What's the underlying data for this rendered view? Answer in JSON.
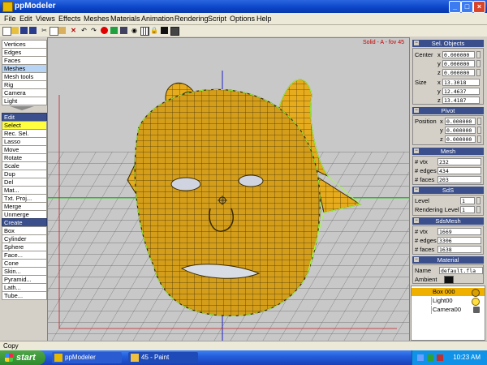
{
  "window": {
    "title": "ppModeler"
  },
  "menu": [
    "File",
    "Edit",
    "Views",
    "Effects",
    "Meshes",
    "Materials",
    "Animation",
    "Rendering",
    "Script",
    "Options",
    "Help"
  ],
  "toolbar_icons": [
    "new-icon",
    "open-icon",
    "save-icon",
    "save-as-icon",
    "cut-icon",
    "copy-icon",
    "paste-icon",
    "delete-icon",
    "undo-icon",
    "redo-icon",
    "record-icon",
    "render-icon",
    "preview-icon",
    "eye-icon",
    "grid-icon",
    "lock-icon",
    "view-mode-icon",
    "layout-icon"
  ],
  "left_panel": {
    "modes": [
      "Vertices",
      "Edges",
      "Faces",
      "Meshes",
      "Mesh tools",
      "Rig",
      "Camera",
      "Light"
    ],
    "edit_header": "Edit",
    "edit_items": [
      "Select",
      "Rec. Sel.",
      "Lasso",
      "Move",
      "Rotate",
      "Scale",
      "Dup",
      "Del",
      "Mat...",
      "Txt. Proj...",
      "Merge",
      "Unmerge"
    ],
    "create_header": "Create",
    "create_items": [
      "Box",
      "Cylinder",
      "Sphere",
      "Face...",
      "Cone",
      "Skin...",
      "Pyramid...",
      "Lath...",
      "Tube..."
    ]
  },
  "viewport": {
    "status": "Solid - A - fov 45"
  },
  "panels": {
    "sel_objects": {
      "title": "Sel. Objects",
      "center_label": "Center",
      "size_label": "Size",
      "center": {
        "x": "0.000000",
        "y": "0.000000",
        "z": "0.000000"
      },
      "size": {
        "x": "13.3018",
        "y": "12.4637",
        "z": "13.4187"
      }
    },
    "pivot": {
      "title": "Pivot",
      "position_label": "Position",
      "x": "0.000000",
      "y": "0.000000",
      "z": "0.000000"
    },
    "mesh": {
      "title": "Mesh",
      "vtx_label": "# vtx",
      "edges_label": "# edges",
      "faces_label": "# faces",
      "vtx": "232",
      "edges": "434",
      "faces": "203"
    },
    "sds": {
      "title": "SdS",
      "level_label": "Level",
      "rlevel_label": "Rendering Level",
      "level": "1",
      "rendering_level": "1"
    },
    "sdsmesh": {
      "title": "SdsMesh",
      "vtx_label": "# vtx",
      "edges_label": "# edges",
      "faces_label": "# faces",
      "vtx": "1669",
      "edges": "3306",
      "faces": "1638"
    },
    "material": {
      "title": "Material",
      "name_label": "Name",
      "ambient_label": "Ambient",
      "name": "default.fla"
    }
  },
  "axis_labels": {
    "x": "x",
    "y": "y",
    "z": "z"
  },
  "scene_list": [
    {
      "label": "Box 000",
      "selected": true,
      "icon": "mesh-icon"
    },
    {
      "label": "Light00",
      "selected": false,
      "icon": "light-icon"
    },
    {
      "label": "Camera00",
      "selected": false,
      "icon": "camera-icon"
    }
  ],
  "status_bar": {
    "text": "Copy"
  },
  "taskbar": {
    "start": "start",
    "tasks": [
      "ppModeler",
      "45 - Paint"
    ],
    "clock": "10:23 AM"
  },
  "colors": {
    "title_blue": "#0a44c8",
    "model_gold": "#e0a820",
    "mesh_lines": "#3a2a00",
    "selection_green": "#a0ff40",
    "header_blue": "#3a4f8c"
  }
}
